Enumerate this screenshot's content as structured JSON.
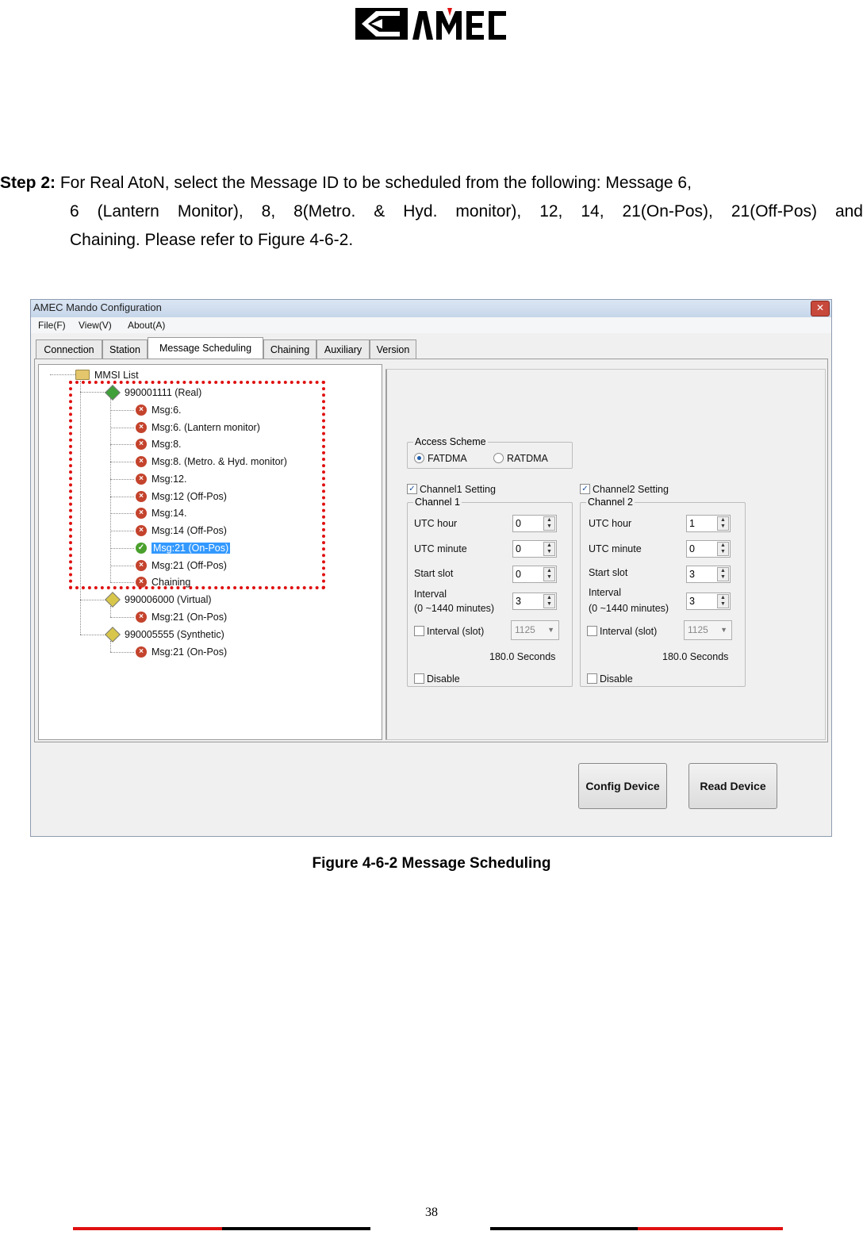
{
  "header": {
    "logo_text": "AMEC",
    "logo_name": "amec-logo"
  },
  "step": {
    "label": "Step 2:",
    "line1": " For Real AtoN, select the Message ID to be scheduled from the following: Message 6,",
    "line2": "6 (Lantern Monitor), 8, 8(Metro. & Hyd. monitor), 12, 14, 21(On-Pos), 21(Off-Pos) and",
    "line3": "Chaining. Please refer to Figure 4-6-2."
  },
  "window": {
    "title": "AMEC Mando Configuration",
    "close_glyph": "✕",
    "menu": [
      "File(F)",
      "View(V)",
      "About(A)"
    ],
    "tabs": [
      "Connection",
      "Station",
      "Message Scheduling",
      "Chaining",
      "Auxiliary",
      "Version"
    ],
    "active_tab": "Message Scheduling",
    "tree": {
      "root": "MMSI List",
      "items": [
        {
          "label": "990001111  (Real)",
          "icon": "green-diamond-icon"
        },
        {
          "label": "Msg:6.",
          "icon": "x-icon"
        },
        {
          "label": "Msg:6. (Lantern monitor)",
          "icon": "x-icon"
        },
        {
          "label": "Msg:8.",
          "icon": "x-icon"
        },
        {
          "label": "Msg:8. (Metro. & Hyd. monitor)",
          "icon": "x-icon"
        },
        {
          "label": "Msg:12.",
          "icon": "x-icon"
        },
        {
          "label": "Msg:12  (Off-Pos)",
          "icon": "x-icon"
        },
        {
          "label": "Msg:14.",
          "icon": "x-icon"
        },
        {
          "label": "Msg:14  (Off-Pos)",
          "icon": "x-icon"
        },
        {
          "label": "Msg:21  (On-Pos)",
          "icon": "check-icon",
          "selected": true
        },
        {
          "label": "Msg:21  (Off-Pos)",
          "icon": "x-icon"
        },
        {
          "label": "Chaining",
          "icon": "x-icon"
        },
        {
          "label": "990006000  (Virtual)",
          "icon": "yellow-diamond-icon"
        },
        {
          "label": "Msg:21  (On-Pos)",
          "icon": "x-icon"
        },
        {
          "label": "990005555  (Synthetic)",
          "icon": "yellow-diamond-icon"
        },
        {
          "label": "Msg:21  (On-Pos)",
          "icon": "x-icon"
        }
      ]
    },
    "access_scheme": {
      "legend": "Access Scheme",
      "options": [
        "FATDMA",
        "RATDMA"
      ],
      "selected": "FATDMA"
    },
    "channel1": {
      "setting_label": "Channel1 Setting",
      "setting_checked": true,
      "legend": "Channel 1",
      "utc_hour_label": "UTC hour",
      "utc_hour": "0",
      "utc_minute_label": "UTC minute",
      "utc_minute": "0",
      "start_slot_label": "Start slot",
      "start_slot": "0",
      "interval_label": "Interval",
      "interval_range": " (0 ~1440 minutes)",
      "interval": "3",
      "interval_slot_label": "Interval (slot)",
      "interval_slot": "1125",
      "seconds": "180.0 Seconds",
      "disable_label": "Disable"
    },
    "channel2": {
      "setting_label": "Channel2 Setting",
      "setting_checked": true,
      "legend": "Channel 2",
      "utc_hour_label": "UTC hour",
      "utc_hour": "1",
      "utc_minute_label": "UTC minute",
      "utc_minute": "0",
      "start_slot_label": "Start slot",
      "start_slot": "3",
      "interval_label": "Interval",
      "interval_range": "(0 ~1440 minutes)",
      "interval": "3",
      "interval_slot_label": "Interval (slot)",
      "interval_slot": "1125",
      "seconds": "180.0 Seconds",
      "disable_label": "Disable"
    },
    "buttons": {
      "config": "Config Device",
      "read": "Read Device"
    }
  },
  "caption": "Figure 4-6-2 Message Scheduling",
  "footer": {
    "page_number": "38",
    "bar_colors": [
      "#e01010",
      "#000000"
    ]
  }
}
